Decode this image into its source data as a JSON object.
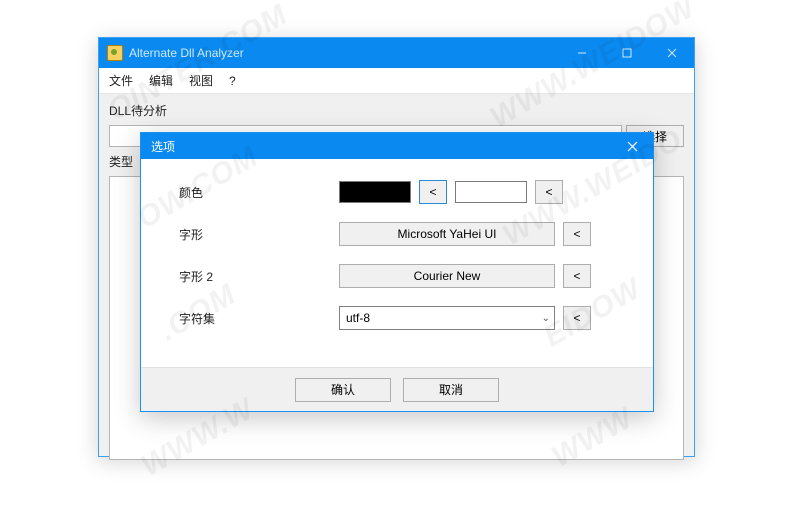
{
  "mainWindow": {
    "title": "Alternate Dll Analyzer",
    "menu": {
      "file": "文件",
      "edit": "编辑",
      "view": "视图",
      "help": "?"
    },
    "dllLabel": "DLL待分析",
    "selectBtn": "选择",
    "typeLabel": "类型"
  },
  "dialog": {
    "title": "选项",
    "labels": {
      "color": "颜色",
      "font": "字形",
      "font2": "字形 2",
      "charset": "字符集"
    },
    "colorSwatch1": "#000000",
    "colorSwatch2": "#FFFFFF",
    "resetGlyph": "<",
    "font1Value": "Microsoft YaHei UI",
    "font2Value": "Courier New",
    "charsetValue": "utf-8",
    "ok": "确认",
    "cancel": "取消"
  }
}
